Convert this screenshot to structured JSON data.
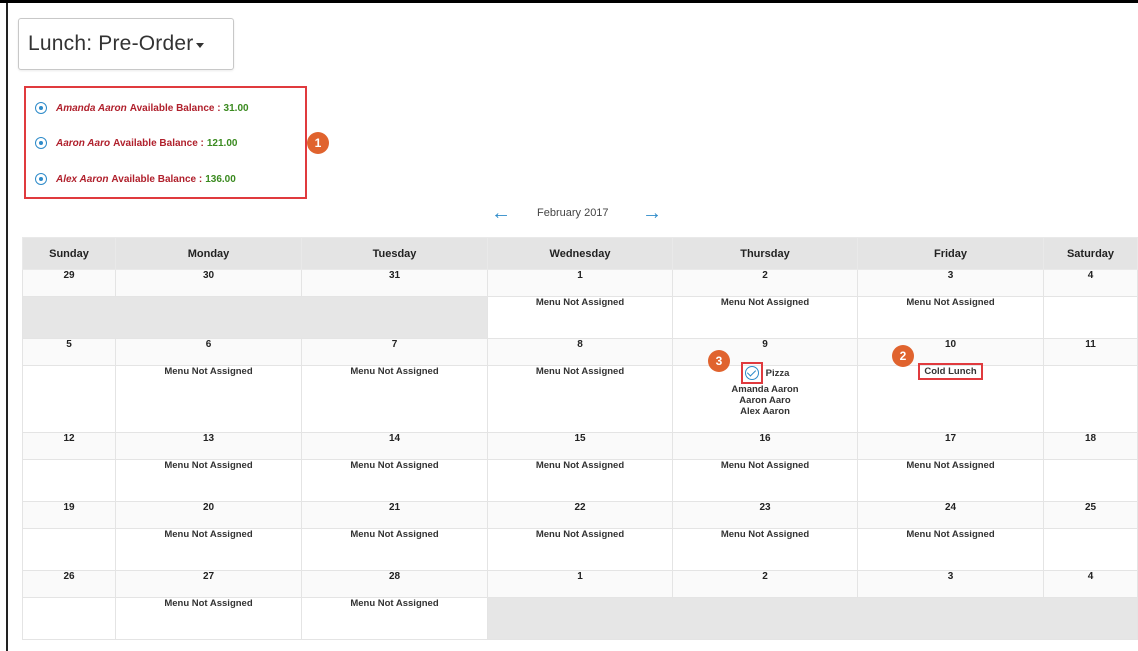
{
  "meal_dropdown": {
    "label": "Lunch: Pre-Order"
  },
  "students": [
    {
      "name": "Amanda Aaron",
      "balance_label": "Available Balance :",
      "amount": "31.00"
    },
    {
      "name": "Aaron Aaro",
      "balance_label": "Available Balance :",
      "amount": "121.00"
    },
    {
      "name": "Alex Aaron",
      "balance_label": "Available Balance :",
      "amount": "136.00"
    }
  ],
  "badges": {
    "one": "1",
    "two": "2",
    "three": "3"
  },
  "nav": {
    "prev_arrow": "←",
    "next_arrow": "→",
    "month": "February 2017"
  },
  "weekdays": [
    "Sunday",
    "Monday",
    "Tuesday",
    "Wednesday",
    "Thursday",
    "Friday",
    "Saturday"
  ],
  "menu_text": "Menu Not Assigned",
  "weeks": [
    [
      "29",
      "30",
      "31",
      "1",
      "2",
      "3",
      "4"
    ],
    [
      "5",
      "6",
      "7",
      "8",
      "9",
      "10",
      "11"
    ],
    [
      "12",
      "13",
      "14",
      "15",
      "16",
      "17",
      "18"
    ],
    [
      "19",
      "20",
      "21",
      "22",
      "23",
      "24",
      "25"
    ],
    [
      "26",
      "27",
      "28",
      "1",
      "2",
      "3",
      "4"
    ]
  ],
  "thursday_9": {
    "item": "Pizza",
    "names": [
      "Amanda Aaron",
      "Aaron Aaro",
      "Alex Aaron"
    ]
  },
  "friday_10": {
    "item": "Cold Lunch"
  },
  "icons": {
    "radio": "radio-selected-icon",
    "check": "check-circle-icon",
    "caret": "caret-down-icon"
  },
  "colors": {
    "accent": "#2e8bc9",
    "highlight": "#e03a3e",
    "badge": "#e0632e",
    "student": "#b0202c",
    "amount": "#3a8a1f"
  }
}
